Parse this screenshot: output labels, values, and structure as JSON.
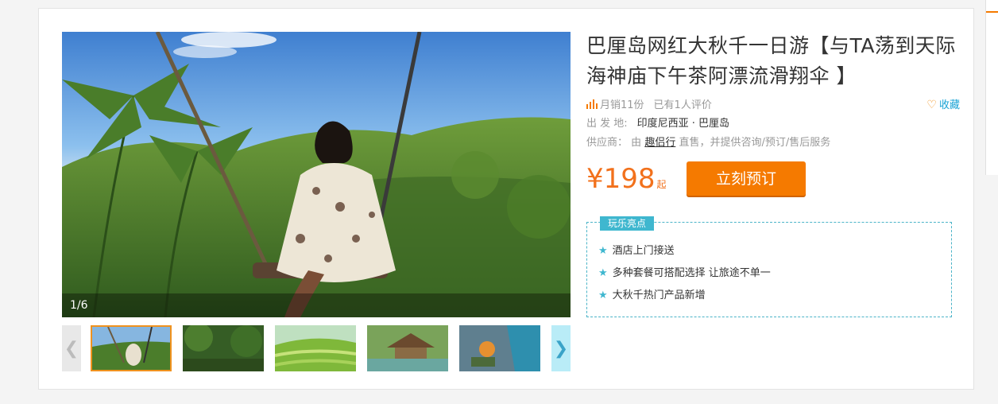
{
  "product": {
    "title": "巴厘岛网红大秋千一日游【与TA荡到天际 海神庙下午茶阿漂流滑翔伞 】",
    "sales": "月销11份",
    "reviews": "已有1人评价",
    "favorite": "收藏",
    "departure_label": "出 发 地:",
    "departure_value": "印度尼西亚 · 巴厘岛",
    "supplier_label": "供应商：",
    "supplier_prefix": "由",
    "supplier_name": "趣侣行",
    "supplier_suffix": "直售，并提供咨询/预订/售后服务",
    "price": "¥198",
    "price_suffix": "起",
    "book_button": "立刻预订"
  },
  "gallery": {
    "counter": "1/6",
    "prev_icon": "chevron-left-icon",
    "next_icon": "chevron-right-icon",
    "thumbs": [
      {
        "name": "thumb-1"
      },
      {
        "name": "thumb-2"
      },
      {
        "name": "thumb-3"
      },
      {
        "name": "thumb-4"
      },
      {
        "name": "thumb-5"
      }
    ]
  },
  "highlights": {
    "tag": "玩乐亮点",
    "items": [
      "酒店上门接送",
      "多种套餐可搭配选择 让旅途不单一",
      "大秋千热门产品新增"
    ]
  },
  "colors": {
    "accent": "#f57a00",
    "price": "#f2711c",
    "teal": "#3fb7cf",
    "link_blue": "#1aa3d5"
  }
}
